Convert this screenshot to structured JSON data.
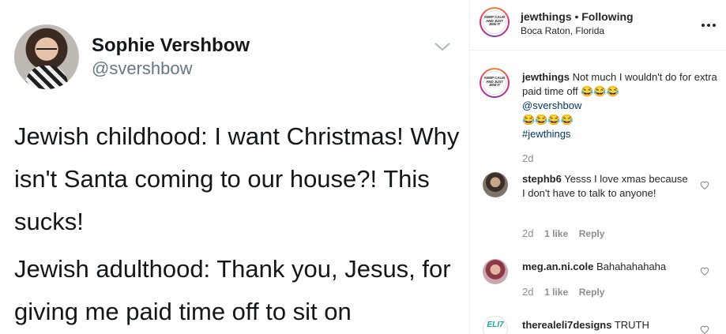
{
  "tweet": {
    "author_name": "Sophie Vershbow",
    "author_handle": "@svershbow",
    "paragraph_1": "Jewish childhood: I want Christmas! Why isn't Santa coming to our house?! This sucks!",
    "paragraph_2": "Jewish adulthood: Thank you, Jesus, for giving me paid time off to sit on"
  },
  "post": {
    "account": "jewthings",
    "separator": " • ",
    "follow_status": "Following",
    "location": "Boca Raton, Florida",
    "avatar_logo_text": "KEEP CALM AND JUST JEW IT",
    "caption": {
      "username": "jewthings",
      "text": "Not much I wouldn't do for extra paid time off 😂😂😂",
      "mention": "@svershbow",
      "emoji_line": "😂😂😂😂",
      "hashtag": "#jewthings",
      "time": "2d"
    },
    "comments": [
      {
        "username": "stephb6",
        "text": "Yesss I love xmas because I don't have to talk to anyone!",
        "time": "2d",
        "likes": "1 like",
        "reply": "Reply"
      },
      {
        "username": "meg.an.ni.cole",
        "text": "Bahahahahaha",
        "time": "2d",
        "likes": "1 like",
        "reply": "Reply"
      },
      {
        "username": "therealeli7designs",
        "text": "TRUTH",
        "avatar_text": "ELI7"
      }
    ]
  }
}
